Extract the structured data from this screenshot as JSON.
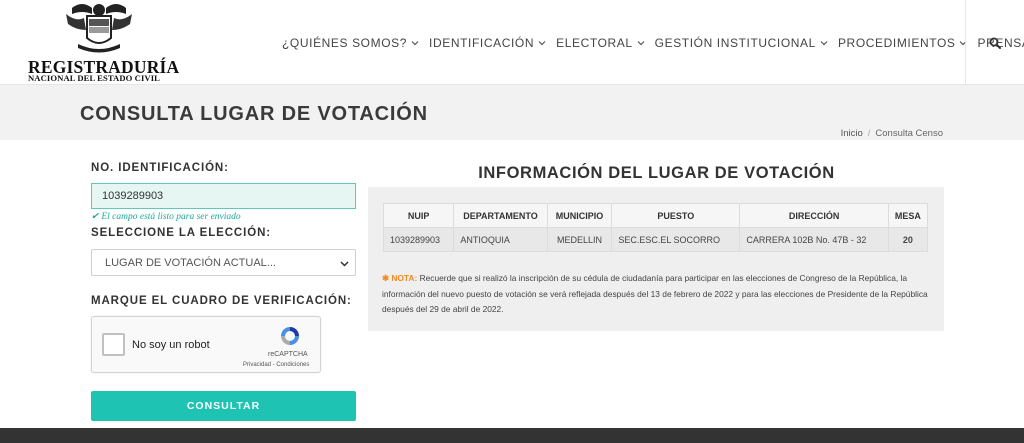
{
  "header": {
    "brand": "REGISTRADURÍA",
    "brand_sub": "NACIONAL DEL ESTADO CIVIL",
    "nav": [
      {
        "label": "¿QUIÉNES SOMOS?"
      },
      {
        "label": "IDENTIFICACIÓN"
      },
      {
        "label": "ELECTORAL"
      },
      {
        "label": "GESTIÓN INSTITUCIONAL"
      },
      {
        "label": "PROCEDIMIENTOS"
      },
      {
        "label": "PRENSA"
      }
    ],
    "search_icon": "search-icon"
  },
  "page": {
    "title": "CONSULTA LUGAR DE VOTACIÓN",
    "breadcrumb": [
      "Inicio",
      "Consulta Censo"
    ]
  },
  "form": {
    "id_label": "NO. IDENTIFICACIÓN:",
    "id_value": "1039289903",
    "hint": "✔ El campo está listo para ser enviado",
    "election_label": "SELECCIONE LA ELECCIÓN:",
    "election_value": "LUGAR DE VOTACIÓN ACTUAL...",
    "captcha_label": "MARQUE EL CUADRO DE VERIFICACIÓN:",
    "captcha": {
      "text": "No soy un robot",
      "brand": "reCAPTCHA",
      "links": "Privacidad - Condiciones"
    },
    "submit_label": "CONSULTAR"
  },
  "info": {
    "title": "INFORMACIÓN DEL LUGAR DE VOTACIÓN",
    "columns": [
      "NUIP",
      "DEPARTAMENTO",
      "MUNICIPIO",
      "PUESTO",
      "DIRECCIÓN",
      "MESA"
    ],
    "row": {
      "nuip": "1039289903",
      "departamento": "ANTIOQUIA",
      "municipio": "MEDELLIN",
      "puesto": "SEC.ESC.EL SOCORRO",
      "direccion": "CARRERA 102B No. 47B - 32",
      "mesa": "20"
    },
    "note_tag": "✱ NOTA:",
    "note_text": "Recuerde que si realizó la inscripción de su cédula de ciudadanía para participar en las elecciones de Congreso de la República, la información del nuevo puesto de votación se verá reflejada después del 13 de febrero de 2022 y para las elecciones de Presidente de la República después del 29 de abril de 2022."
  },
  "colors": {
    "accent": "#1ec3b3",
    "input_bg": "#e6f6f3",
    "footer": "#333333",
    "note_tag": "#f28b1f"
  }
}
